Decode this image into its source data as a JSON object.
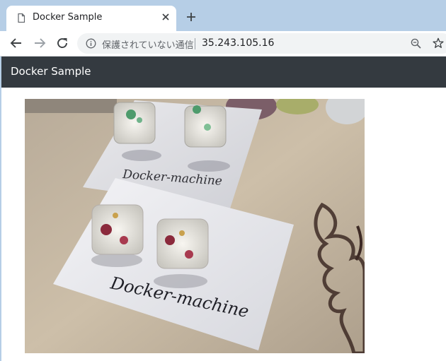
{
  "browser": {
    "tab_title": "Docker Sample",
    "security_text": "保護されていない通信",
    "url": "35.243.105.16",
    "icons": [
      "document-icon",
      "close-icon",
      "new-tab-icon",
      "back-arrow-icon",
      "forward-arrow-icon",
      "reload-icon",
      "info-icon",
      "zoom-icon",
      "star-icon"
    ]
  },
  "navbar": {
    "brand": "Docker Sample"
  },
  "photo": {
    "card_texts": [
      "Docker-machine",
      "Docker-machine"
    ]
  }
}
